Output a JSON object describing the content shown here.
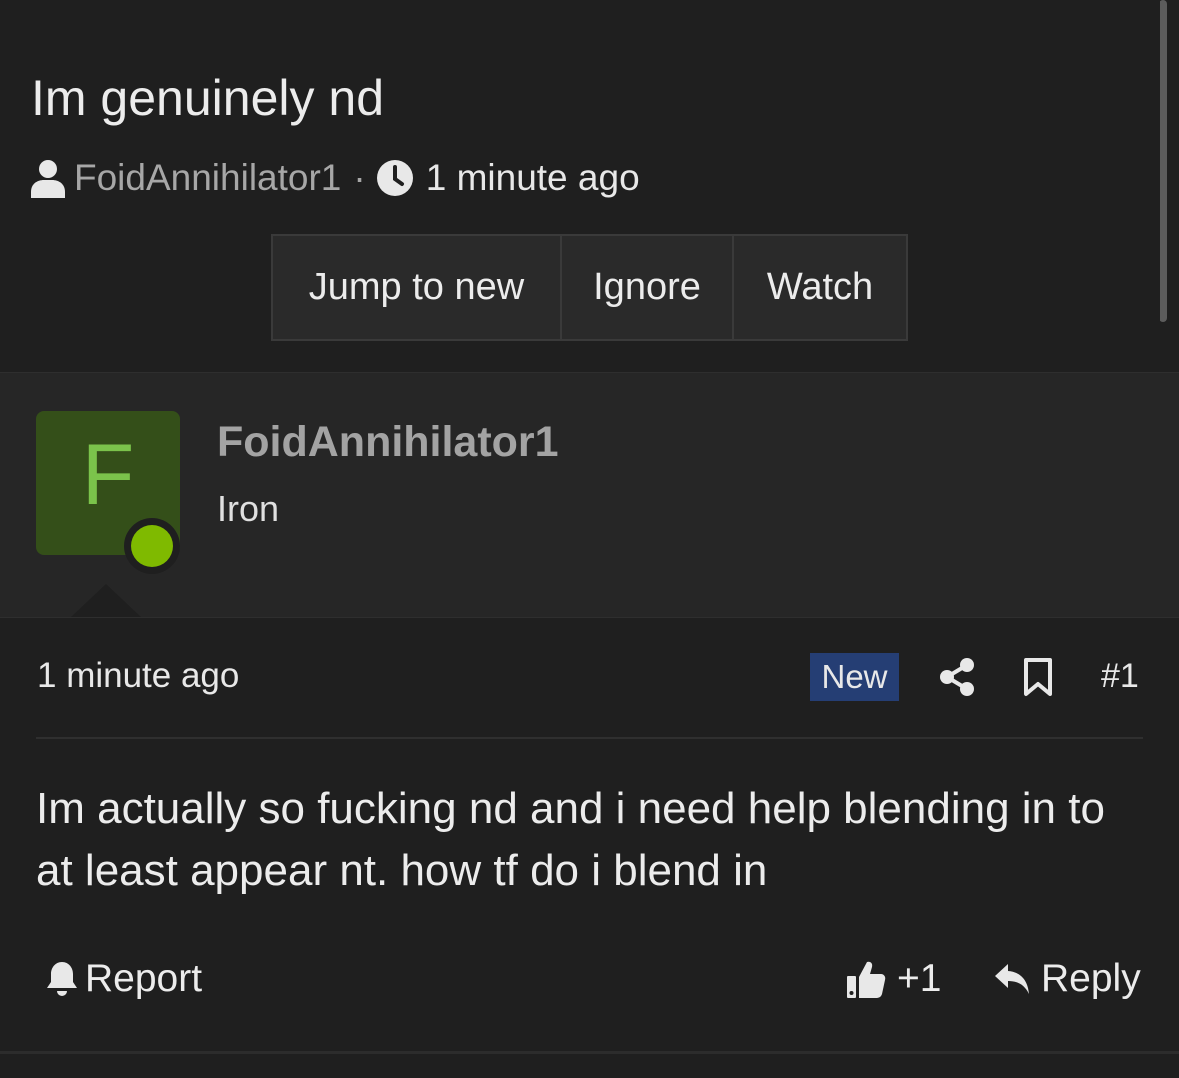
{
  "thread": {
    "title": "Im genuinely nd",
    "author": "FoidAnnihilator1",
    "separator": "·",
    "time": "1 minute ago",
    "buttons": {
      "jump": "Jump to new",
      "ignore": "Ignore",
      "watch": "Watch"
    }
  },
  "post": {
    "avatar_letter": "F",
    "user_name": "FoidAnnihilator1",
    "user_title": "Iron",
    "time": "1 minute ago",
    "badge": "New",
    "number": "#1",
    "content": "Im actually so fucking nd and i need help blending in to at least appear nt. how tf do i blend in",
    "actions": {
      "report": "Report",
      "like_count": "+1",
      "reply": "Reply"
    }
  },
  "colors": {
    "background": "#1f1f1f",
    "avatar_bg": "#344f19",
    "avatar_letter": "#7bc34b",
    "online": "#7fba00",
    "badge_new": "#253e74"
  },
  "icons": [
    "user-icon",
    "clock-icon",
    "share-icon",
    "bookmark-icon",
    "bell-icon",
    "thumbs-up-icon",
    "reply-icon"
  ]
}
